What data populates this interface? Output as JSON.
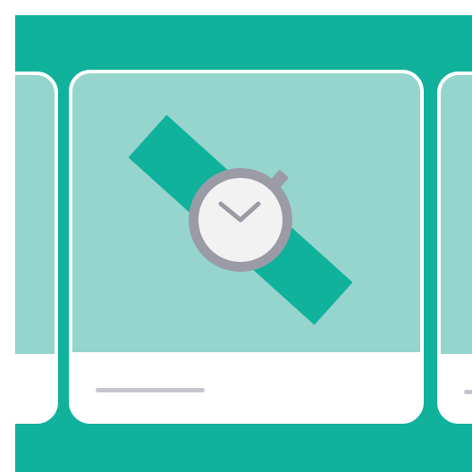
{
  "scene": {
    "background_color": "#10b29c",
    "card_media_color": "#96d5cd",
    "card_footer_color": "#ffffff",
    "placeholder_line_color": "#c5c5cc"
  },
  "carousel": {
    "cards": [
      {
        "position": "previous",
        "icon": null
      },
      {
        "position": "current",
        "icon": "wristwatch-icon"
      },
      {
        "position": "next",
        "icon": null
      }
    ]
  },
  "icons": {
    "watch": {
      "name": "wristwatch-icon",
      "strap_color": "#10b29c",
      "case_color": "#9b9ba6",
      "face_color": "#f2f2f2"
    }
  }
}
